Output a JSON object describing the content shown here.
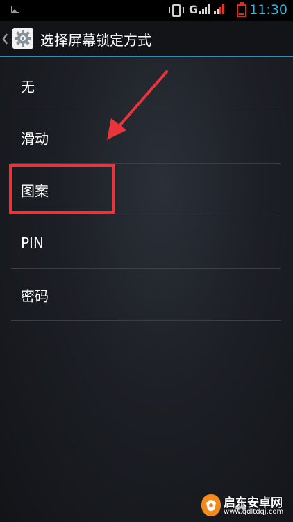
{
  "status_bar": {
    "network_type": "G",
    "time": "11:30",
    "icons": [
      "gallery-icon",
      "vibrate-icon",
      "signal-icon",
      "battery-icon"
    ]
  },
  "action_bar": {
    "title": "选择屏幕锁定方式",
    "back_icon": "chevron-left-icon",
    "app_icon": "settings-icon"
  },
  "lock_options": [
    {
      "label": "无"
    },
    {
      "label": "滑动"
    },
    {
      "label": "图案"
    },
    {
      "label": "PIN"
    },
    {
      "label": "密码"
    }
  ],
  "annotation": {
    "highlighted_option": "图案",
    "highlight_color": "#e8343a",
    "arrow_color": "#e8343a"
  },
  "watermark": {
    "name": "启东安卓网",
    "url": "www.qdltdqj.com"
  },
  "colors": {
    "accent": "#33b5e5",
    "action_bar_line": "#2d8fbe",
    "battery": "#e02a20"
  }
}
